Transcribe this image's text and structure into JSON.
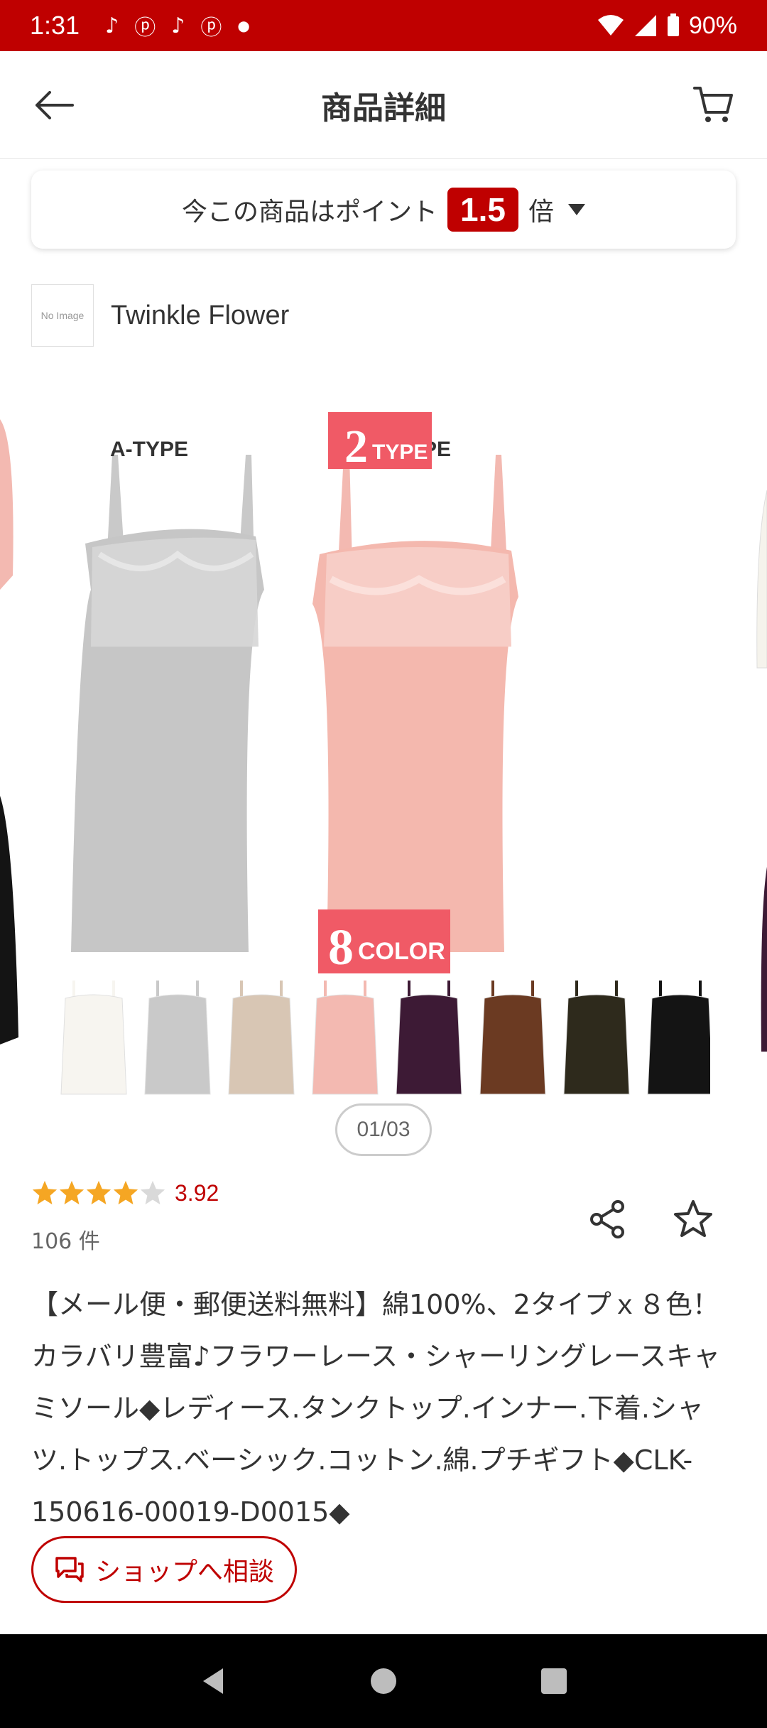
{
  "status_bar": {
    "time": "1:31",
    "battery": "90%",
    "app_icons": [
      "tiktok-icon",
      "pinterest-icon",
      "tiktok-icon",
      "pinterest-icon",
      "dot-icon"
    ]
  },
  "header": {
    "title": "商品詳細",
    "back_icon": "arrow-left-icon",
    "cart_icon": "cart-icon"
  },
  "points": {
    "prefix": "今この商品はポイント",
    "multiplier": "1.5",
    "suffix": "倍"
  },
  "shop": {
    "logo_text": "No Image",
    "name": "Twinkle Flower"
  },
  "image": {
    "type_a_label": "A-TYPE",
    "type_b_label": "B-TYPE",
    "type_count_num": "2",
    "type_count_word": "TYPE",
    "color_count_num": "8",
    "color_count_word": "COLOR",
    "swatches": [
      "#f7f5f0",
      "#c9c9c9",
      "#d8c6b4",
      "#f3b9b1",
      "#3d1a35",
      "#6b3a22",
      "#2e2a1c",
      "#141414"
    ]
  },
  "carousel": {
    "indicator": "01/03"
  },
  "rating": {
    "value": "3.92",
    "stars": 4,
    "count": "106 件"
  },
  "product": {
    "title": "【メール便・郵便送料無料】綿100%、2タイプｘ８色！カラバリ豊富♪フラワーレース・シャーリングレースキャミソール◆レディース.タンクトップ.インナー.下着.シャツ.トップス.ベーシック.コットン.綿.プチギフト◆CLK-150616-00019-D0015◆"
  },
  "consult": {
    "label": "ショップへ相談"
  },
  "colors": {
    "accent": "#bf0000",
    "star": "#f5a623"
  }
}
